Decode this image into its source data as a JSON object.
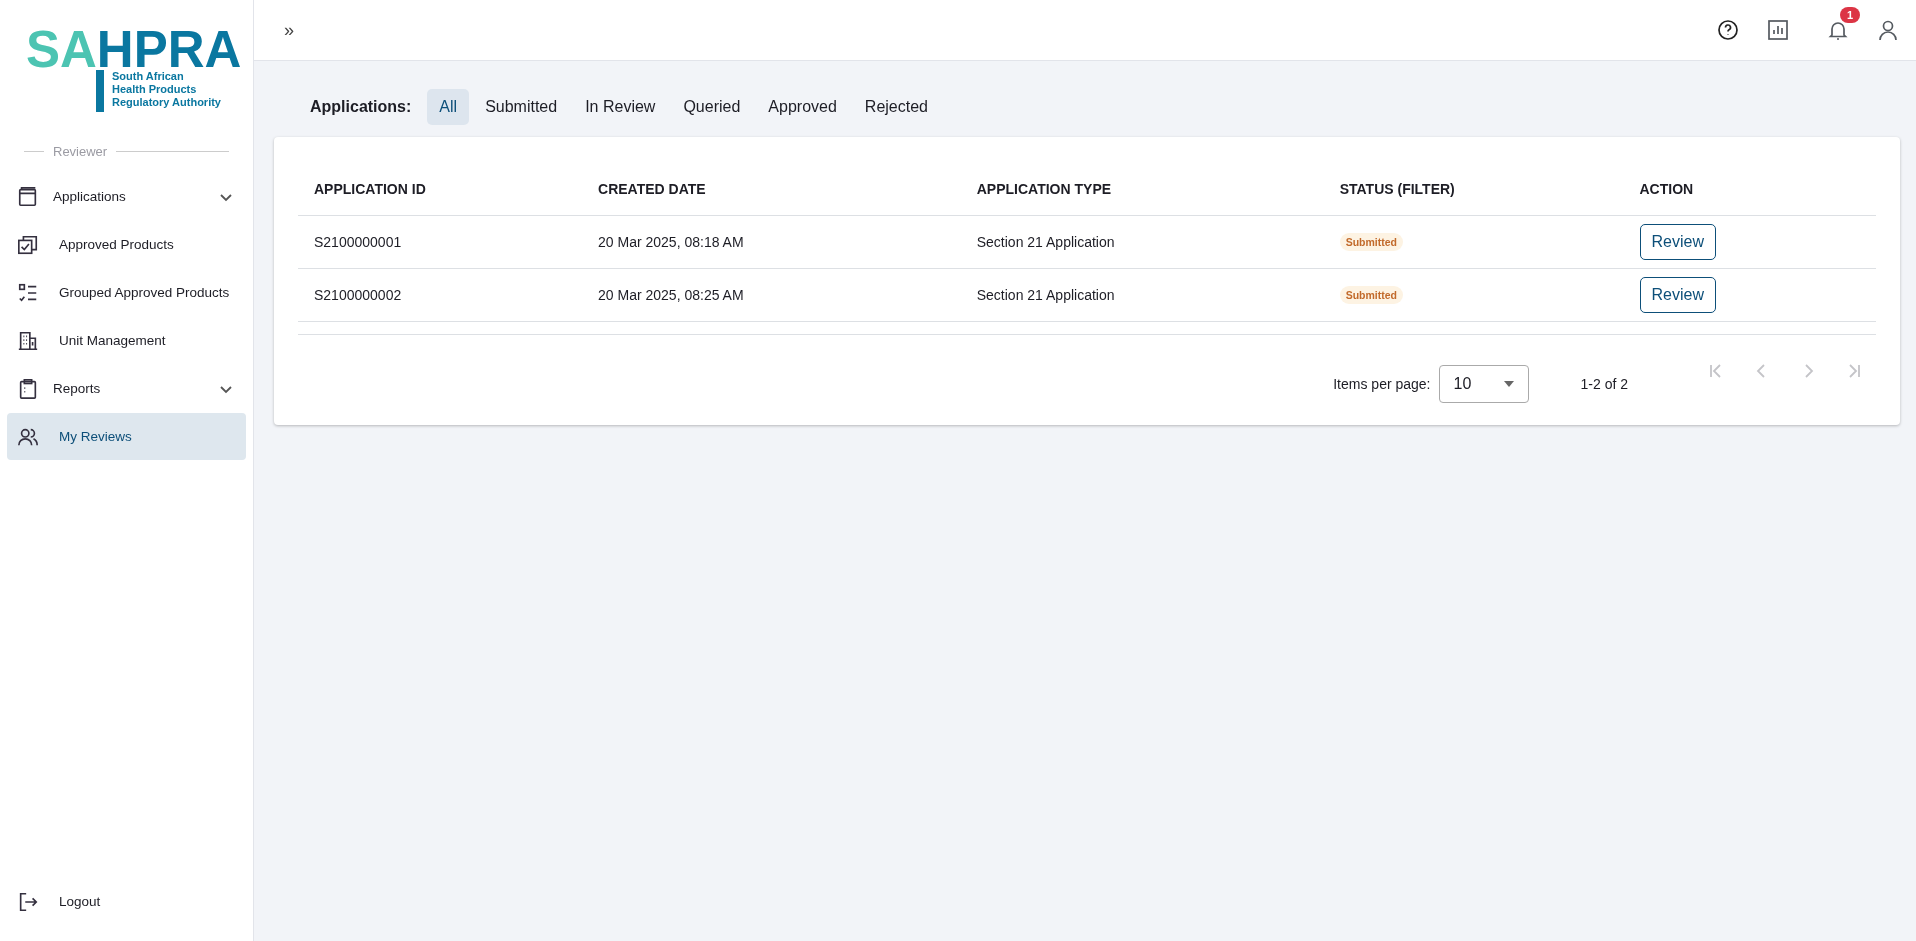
{
  "logo": {
    "lead": "SA",
    "rest": "HPRA",
    "tagline": [
      "South African",
      "Health Products",
      "Regulatory Authority"
    ]
  },
  "sidebar": {
    "role": "Reviewer",
    "items": [
      {
        "kind": "group",
        "label": "Applications",
        "expanded": false,
        "selected": false
      },
      {
        "kind": "link",
        "label": "Approved Products",
        "selected": false
      },
      {
        "kind": "link",
        "label": "Grouped Approved Products",
        "selected": false
      },
      {
        "kind": "link",
        "label": "Unit Management",
        "selected": false
      },
      {
        "kind": "group",
        "label": "Reports",
        "expanded": false,
        "selected": false
      },
      {
        "kind": "link",
        "label": "My Reviews",
        "selected": true
      }
    ],
    "logout": "Logout"
  },
  "topbar": {
    "expand": "»",
    "notifications": "1"
  },
  "filter": {
    "label": "Applications:",
    "tabs": [
      {
        "label": "All",
        "selected": true
      },
      {
        "label": "Submitted",
        "selected": false
      },
      {
        "label": "In Review",
        "selected": false
      },
      {
        "label": "Queried",
        "selected": false
      },
      {
        "label": "Approved",
        "selected": false
      },
      {
        "label": "Rejected",
        "selected": false
      }
    ]
  },
  "table": {
    "columns": [
      "APPLICATION ID",
      "CREATED DATE",
      "APPLICATION TYPE",
      "STATUS (FILTER)",
      "ACTION"
    ],
    "rows": [
      {
        "id": "S2100000001",
        "created": "20 Mar 2025, 08:18 AM",
        "type": "Section 21 Application",
        "status": "Submitted",
        "action": "Review"
      },
      {
        "id": "S2100000002",
        "created": "20 Mar 2025, 08:25 AM",
        "type": "Section 21 Application",
        "status": "Submitted",
        "action": "Review"
      }
    ]
  },
  "pagination": {
    "label": "Items per page:",
    "page_size": "10",
    "range": "1-2 of 2",
    "buttons": [
      {
        "kind": "first",
        "disabled": true
      },
      {
        "kind": "prev",
        "disabled": true
      },
      {
        "kind": "next",
        "disabled": true
      },
      {
        "kind": "last",
        "disabled": true
      }
    ]
  }
}
